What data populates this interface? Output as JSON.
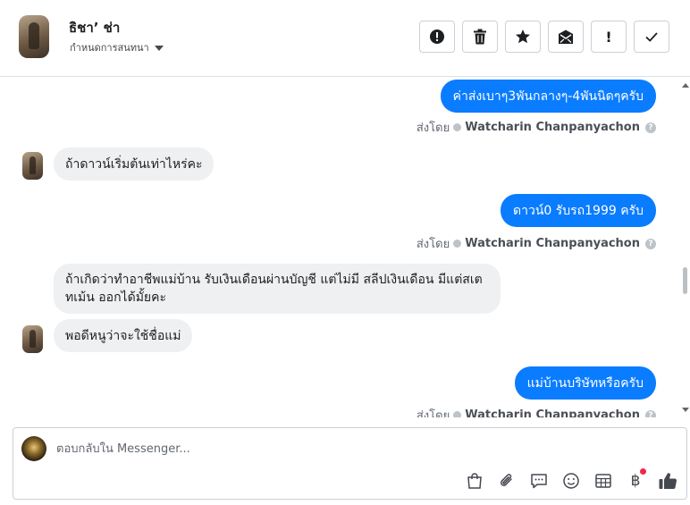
{
  "header": {
    "contact_name": "ธิชา’ ช่า",
    "conversation_settings": "กำหนดการสนทนา",
    "toolbar": [
      {
        "name": "spam-button",
        "icon": "alert-circle-icon"
      },
      {
        "name": "delete-button",
        "icon": "trash-icon"
      },
      {
        "name": "star-button",
        "icon": "star-icon"
      },
      {
        "name": "mark-unread-button",
        "icon": "envelope-icon"
      },
      {
        "name": "follow-up-button",
        "icon": "exclamation-icon",
        "label": "!"
      },
      {
        "name": "mark-done-button",
        "icon": "checkmark-icon"
      }
    ]
  },
  "messages": [
    {
      "direction": "outgoing",
      "text": "ค่าส่งเบาๆ3พันกลางๆ-4พันนิดๆครับ"
    },
    {
      "direction": "outgoing-meta",
      "prefix": "ส่งโดย",
      "sender": "Watcharin Chanpanyachon",
      "help": "?"
    },
    {
      "direction": "incoming",
      "text": "ถ้าดาวน์เริ่มต้นเท่าไหร่คะ"
    },
    {
      "direction": "outgoing",
      "text": "ดาวน์0 รับรถ1999 ครับ"
    },
    {
      "direction": "outgoing-meta",
      "prefix": "ส่งโดย",
      "sender": "Watcharin Chanpanyachon",
      "help": "?"
    },
    {
      "direction": "incoming",
      "text": "ถ้าเกิดว่าทำอาชีพแม่บ้าน รับเงินเดือนผ่านบัญชี  แต่ไม่มี สลีปเงินเดือน  มีแต่สเตทเม้น  ออกได้มั้ยคะ"
    },
    {
      "direction": "incoming",
      "text": "พอดีหนูว่าจะใช้ชื่อแม่"
    },
    {
      "direction": "outgoing",
      "text": "แม่บ้านบริษัทหรือครับ"
    },
    {
      "direction": "outgoing-meta",
      "prefix": "ส่งโดย",
      "sender": "Watcharin Chanpanyachon",
      "help": "?"
    }
  ],
  "composer": {
    "placeholder": "ตอบกลับใน Messenger...",
    "tools": [
      "shopping-bag-icon",
      "paperclip-icon",
      "chat-bubble-icon",
      "smiley-icon",
      "table-icon",
      "baht-icon",
      "thumbs-up-icon"
    ],
    "baht_symbol": "฿",
    "accent_color": "#0a7cff",
    "badge_color": "#f02849"
  }
}
